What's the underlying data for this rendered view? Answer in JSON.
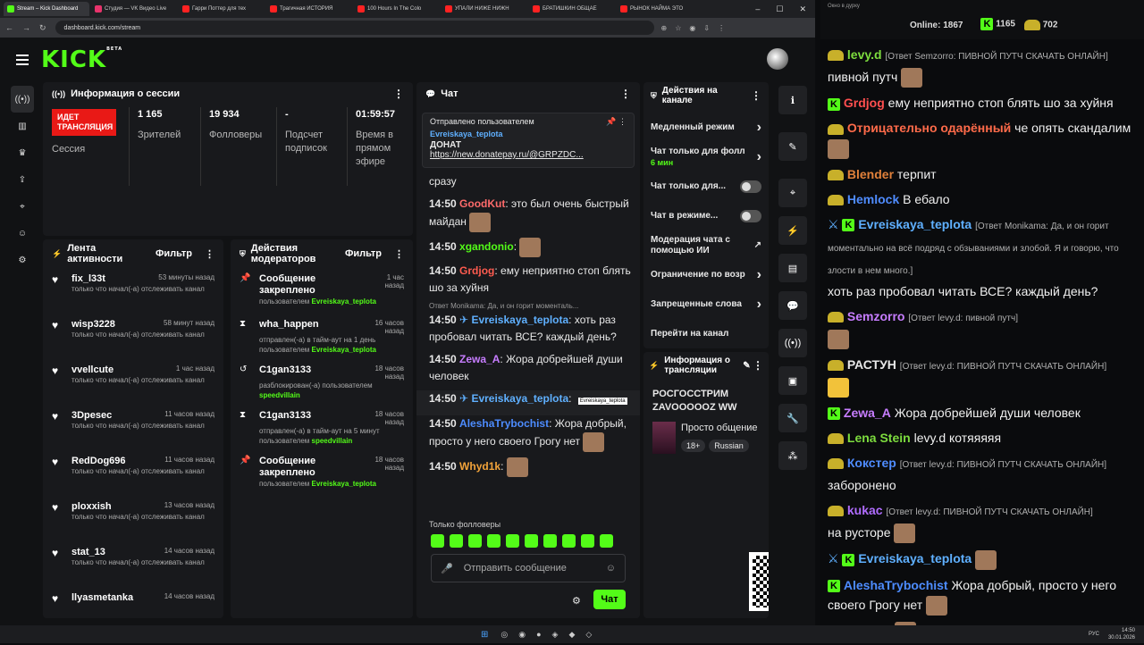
{
  "browser": {
    "tabs": [
      "Stream – Kick Dashboard",
      "Студия — VK Видео Live",
      "Гарри Поттер для тех",
      "Трагичная ИСТОРИЯ",
      "100 Hours In The Colo",
      "УПАЛИ НИЖЕ НИЖН",
      "БРАТИШКИН ОБЩАЕ",
      "РЫНОК НАЙМА ЭТО"
    ],
    "url": "dashboard.kick.com/stream"
  },
  "app": {
    "logo": "KICK",
    "logo_badge": "BETA"
  },
  "session": {
    "title": "Информация о сессии",
    "live": "ИДЕТ ТРАНСЛЯЦИЯ",
    "live_label": "Сессия",
    "viewers": "1 165",
    "viewers_label": "Зрителей",
    "followers": "19 934",
    "followers_label": "Фолловеры",
    "subs": "-",
    "subs_label": "Подсчет подписок",
    "uptime": "01:59:57",
    "uptime_label": "Время в прямом эфире"
  },
  "feed": {
    "title": "Лента активности",
    "filter": "Фильтр",
    "items": [
      {
        "name": "fix_l33t",
        "time": "53 минуты назад",
        "desc": "только что начал(-а) отслеживать канал"
      },
      {
        "name": "wisp3228",
        "time": "58 минут назад",
        "desc": "только что начал(-а) отслеживать канал"
      },
      {
        "name": "vvellcute",
        "time": "1 час назад",
        "desc": "только что начал(-а) отслеживать канал"
      },
      {
        "name": "3Dpesec",
        "time": "11 часов назад",
        "desc": "только что начал(-а) отслеживать канал"
      },
      {
        "name": "RedDog696",
        "time": "11 часов назад",
        "desc": "только что начал(-а) отслеживать канал"
      },
      {
        "name": "ploxxish",
        "time": "13 часов назад",
        "desc": "только что начал(-а) отслеживать канал"
      },
      {
        "name": "stat_13",
        "time": "14 часов назад",
        "desc": "только что начал(-а) отслеживать канал"
      },
      {
        "name": "llyasmetanka",
        "time": "14 часов назад",
        "desc": ""
      }
    ]
  },
  "mod": {
    "title": "Действия модераторов",
    "filter": "Фильтр",
    "items": [
      {
        "name": "Сообщение закреплено",
        "time": "1 час назад",
        "desc": "пользователем ",
        "who": "Evreiskaya_teplota"
      },
      {
        "name": "wha_happen",
        "time": "16 часов назад",
        "desc": "отправлен(-а) в тайм-аут на 1 день пользователем ",
        "who": "Evreiskaya_teplota"
      },
      {
        "name": "C1gan3133",
        "time": "18 часов назад",
        "desc": "разблокирован(-а) пользователем ",
        "who": "speedvillain"
      },
      {
        "name": "C1gan3133",
        "time": "18 часов назад",
        "desc": "отправлен(-а) в тайм-аут на 5 минут пользователем ",
        "who": "speedvillain"
      },
      {
        "name": "Сообщение закреплено",
        "time": "18 часов назад",
        "desc": "пользователем ",
        "who": "Evreiskaya_teplota"
      }
    ]
  },
  "chat": {
    "title": "Чат",
    "pinned_label": "Отправлено пользователем",
    "pinned_user": "Evreiskaya_teplota",
    "pinned_text": "ДОНАТ",
    "pinned_link": "https://new.donatepay.ru/@GRPZDC...",
    "followers_only": "Только фолловеры",
    "input_placeholder": "Отправить сообщение",
    "send": "Чат",
    "reply_hint": "Ответ Monikama: Да, и он горит моменталь...",
    "tooltip": "Evreiskaya_teplota",
    "messages": [
      {
        "time": "",
        "user": "",
        "text": "сразу",
        "color": "#e8e8e8"
      },
      {
        "time": "14:50",
        "user": "GoodKut",
        "text": "это был очень быстрый майдан",
        "color": "#ff6b6b"
      },
      {
        "time": "14:50",
        "user": "xgandonio",
        "text": "",
        "color": "#53fc18"
      },
      {
        "time": "14:50",
        "user": "Grdjog",
        "text": "ему неприятно стоп блять шо за хуйня",
        "color": "#ff5b4f"
      },
      {
        "time": "14:50",
        "user": "Evreiskaya_teplota",
        "text": "хоть раз пробовал читать ВСЕ? каждый день?",
        "color": "#5fb0ff"
      },
      {
        "time": "14:50",
        "user": "Zewa_A",
        "text": "Жора добрейшей души человек",
        "color": "#c77dff"
      },
      {
        "time": "14:50",
        "user": "Evreiskaya_teplota",
        "text": "",
        "color": "#5fb0ff"
      },
      {
        "time": "14:50",
        "user": "AleshaTrybochist",
        "text": "Жора добрый, просто у него своего Грогу нет",
        "color": "#4d8cff"
      },
      {
        "time": "14:50",
        "user": "Whyd1k",
        "text": "",
        "color": "#f2a33a"
      }
    ]
  },
  "actions": {
    "title": "Действия на канале",
    "items": [
      "Медленный режим",
      "Чат только для фолл",
      "Чат только для...",
      "Чат в режиме...",
      "Модерация чата с помощью ИИ",
      "Ограничение по возр",
      "Запрещенные слова",
      "Перейти на канал"
    ],
    "sub": "6 мин"
  },
  "info": {
    "title": "Информация о трансляции",
    "stream_title": "РОСГОССТРИМ ZAVOOOOOZ WW",
    "category": "Просто общение",
    "tags": [
      "18+",
      "Russian"
    ]
  },
  "overlay": {
    "window": "Окно в дурку",
    "online": "Online: 1867",
    "viewers": "1165",
    "subs": "702"
  },
  "rchat": [
    {
      "user": "levy.d",
      "color": "#7ddc3e",
      "reply": "[Ответ Semzorro: ПИВНОЙ ПУТЧ СКАЧАТЬ ОНЛАЙН]",
      "text": "пивной путч"
    },
    {
      "user": "Grdjog",
      "color": "#ff4f4f",
      "reply": "",
      "text": "ему неприятно стоп блять шо за хуйня"
    },
    {
      "user": "Отрицательно одарённый",
      "color": "#ff6b4a",
      "reply": "",
      "text": "че опять скандалим"
    },
    {
      "user": "Blender",
      "color": "#e0803a",
      "reply": "",
      "text": "терпит"
    },
    {
      "user": "Hemlock",
      "color": "#4f8cff",
      "reply": "",
      "text": "В ебало"
    },
    {
      "user": "Evreiskaya_teplota",
      "color": "#5fb0ff",
      "reply": "[Ответ Monikama: Да, и он горит моментально на всё подряд с обзываниями и злобой. Я и говорю, что злости в нем много.]",
      "text": "хоть раз пробовал читать ВСЕ? каждый день?"
    },
    {
      "user": "Semzorro",
      "color": "#c77dff",
      "reply": "[Ответ levy.d: пивной путч]",
      "text": ""
    },
    {
      "user": "РАСТУН",
      "color": "#e8e8e8",
      "reply": "[Ответ levy.d: ПИВНОЙ ПУТЧ СКАЧАТЬ ОНЛАЙН]",
      "text": ""
    },
    {
      "user": "Zewa_A",
      "color": "#c77dff",
      "reply": "",
      "text": "Жора добрейшей души человек"
    },
    {
      "user": "Lena Stein",
      "color": "#7ddc3e",
      "reply": "",
      "text": "levy.d котяяяяя"
    },
    {
      "user": "Кокстер",
      "color": "#4f8cff",
      "reply": "[Ответ levy.d: ПИВНОЙ ПУТЧ СКАЧАТЬ ОНЛАЙН]",
      "text": "забороненo"
    },
    {
      "user": "kukac",
      "color": "#b06cff",
      "reply": "[Ответ levy.d: ПИВНОЙ ПУТЧ СКАЧАТЬ ОНЛАЙН]",
      "text": "на русторе"
    },
    {
      "user": "Evreiskaya_teplota",
      "color": "#5fb0ff",
      "reply": "",
      "text": ""
    },
    {
      "user": "AleshaTrybochist",
      "color": "#4d8cff",
      "reply": "",
      "text": "Жора добрый, просто у него своего Грогу нет"
    },
    {
      "user": "Whyd1k",
      "color": "#f2a33a",
      "reply": "",
      "text": ""
    }
  ],
  "taskbar": {
    "lang": "РУС",
    "time": "14:50",
    "date": "30.01.2026"
  }
}
